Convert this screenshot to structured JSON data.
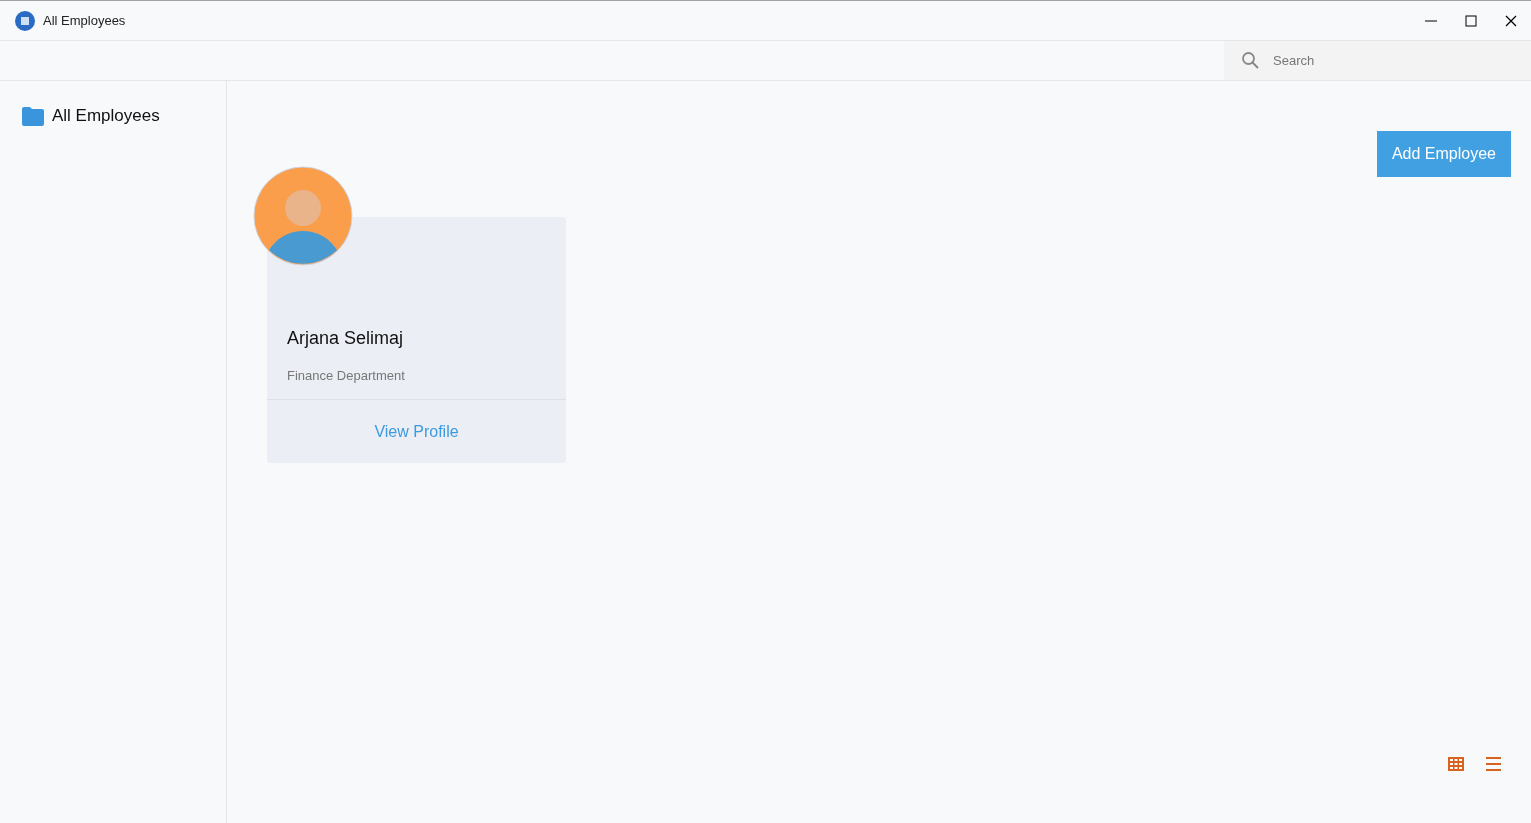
{
  "window": {
    "title": "All Employees"
  },
  "search": {
    "placeholder": "Search"
  },
  "sidebar": {
    "items": [
      {
        "label": "All Employees"
      }
    ]
  },
  "add_button": "Add Employee",
  "employees": [
    {
      "name": "Arjana Selimaj",
      "department": "Finance Department",
      "action": "View Profile"
    }
  ]
}
